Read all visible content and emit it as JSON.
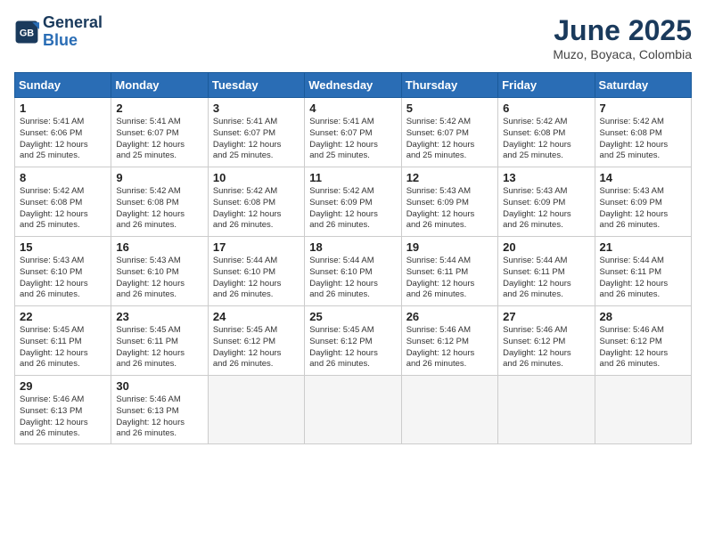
{
  "header": {
    "logo_line1": "General",
    "logo_line2": "Blue",
    "month_title": "June 2025",
    "location": "Muzo, Boyaca, Colombia"
  },
  "weekdays": [
    "Sunday",
    "Monday",
    "Tuesday",
    "Wednesday",
    "Thursday",
    "Friday",
    "Saturday"
  ],
  "weeks": [
    [
      {
        "day": "1",
        "info": "Sunrise: 5:41 AM\nSunset: 6:06 PM\nDaylight: 12 hours\nand 25 minutes."
      },
      {
        "day": "2",
        "info": "Sunrise: 5:41 AM\nSunset: 6:07 PM\nDaylight: 12 hours\nand 25 minutes."
      },
      {
        "day": "3",
        "info": "Sunrise: 5:41 AM\nSunset: 6:07 PM\nDaylight: 12 hours\nand 25 minutes."
      },
      {
        "day": "4",
        "info": "Sunrise: 5:41 AM\nSunset: 6:07 PM\nDaylight: 12 hours\nand 25 minutes."
      },
      {
        "day": "5",
        "info": "Sunrise: 5:42 AM\nSunset: 6:07 PM\nDaylight: 12 hours\nand 25 minutes."
      },
      {
        "day": "6",
        "info": "Sunrise: 5:42 AM\nSunset: 6:08 PM\nDaylight: 12 hours\nand 25 minutes."
      },
      {
        "day": "7",
        "info": "Sunrise: 5:42 AM\nSunset: 6:08 PM\nDaylight: 12 hours\nand 25 minutes."
      }
    ],
    [
      {
        "day": "8",
        "info": "Sunrise: 5:42 AM\nSunset: 6:08 PM\nDaylight: 12 hours\nand 25 minutes."
      },
      {
        "day": "9",
        "info": "Sunrise: 5:42 AM\nSunset: 6:08 PM\nDaylight: 12 hours\nand 26 minutes."
      },
      {
        "day": "10",
        "info": "Sunrise: 5:42 AM\nSunset: 6:08 PM\nDaylight: 12 hours\nand 26 minutes."
      },
      {
        "day": "11",
        "info": "Sunrise: 5:42 AM\nSunset: 6:09 PM\nDaylight: 12 hours\nand 26 minutes."
      },
      {
        "day": "12",
        "info": "Sunrise: 5:43 AM\nSunset: 6:09 PM\nDaylight: 12 hours\nand 26 minutes."
      },
      {
        "day": "13",
        "info": "Sunrise: 5:43 AM\nSunset: 6:09 PM\nDaylight: 12 hours\nand 26 minutes."
      },
      {
        "day": "14",
        "info": "Sunrise: 5:43 AM\nSunset: 6:09 PM\nDaylight: 12 hours\nand 26 minutes."
      }
    ],
    [
      {
        "day": "15",
        "info": "Sunrise: 5:43 AM\nSunset: 6:10 PM\nDaylight: 12 hours\nand 26 minutes."
      },
      {
        "day": "16",
        "info": "Sunrise: 5:43 AM\nSunset: 6:10 PM\nDaylight: 12 hours\nand 26 minutes."
      },
      {
        "day": "17",
        "info": "Sunrise: 5:44 AM\nSunset: 6:10 PM\nDaylight: 12 hours\nand 26 minutes."
      },
      {
        "day": "18",
        "info": "Sunrise: 5:44 AM\nSunset: 6:10 PM\nDaylight: 12 hours\nand 26 minutes."
      },
      {
        "day": "19",
        "info": "Sunrise: 5:44 AM\nSunset: 6:11 PM\nDaylight: 12 hours\nand 26 minutes."
      },
      {
        "day": "20",
        "info": "Sunrise: 5:44 AM\nSunset: 6:11 PM\nDaylight: 12 hours\nand 26 minutes."
      },
      {
        "day": "21",
        "info": "Sunrise: 5:44 AM\nSunset: 6:11 PM\nDaylight: 12 hours\nand 26 minutes."
      }
    ],
    [
      {
        "day": "22",
        "info": "Sunrise: 5:45 AM\nSunset: 6:11 PM\nDaylight: 12 hours\nand 26 minutes."
      },
      {
        "day": "23",
        "info": "Sunrise: 5:45 AM\nSunset: 6:11 PM\nDaylight: 12 hours\nand 26 minutes."
      },
      {
        "day": "24",
        "info": "Sunrise: 5:45 AM\nSunset: 6:12 PM\nDaylight: 12 hours\nand 26 minutes."
      },
      {
        "day": "25",
        "info": "Sunrise: 5:45 AM\nSunset: 6:12 PM\nDaylight: 12 hours\nand 26 minutes."
      },
      {
        "day": "26",
        "info": "Sunrise: 5:46 AM\nSunset: 6:12 PM\nDaylight: 12 hours\nand 26 minutes."
      },
      {
        "day": "27",
        "info": "Sunrise: 5:46 AM\nSunset: 6:12 PM\nDaylight: 12 hours\nand 26 minutes."
      },
      {
        "day": "28",
        "info": "Sunrise: 5:46 AM\nSunset: 6:12 PM\nDaylight: 12 hours\nand 26 minutes."
      }
    ],
    [
      {
        "day": "29",
        "info": "Sunrise: 5:46 AM\nSunset: 6:13 PM\nDaylight: 12 hours\nand 26 minutes."
      },
      {
        "day": "30",
        "info": "Sunrise: 5:46 AM\nSunset: 6:13 PM\nDaylight: 12 hours\nand 26 minutes."
      },
      {
        "day": "",
        "info": ""
      },
      {
        "day": "",
        "info": ""
      },
      {
        "day": "",
        "info": ""
      },
      {
        "day": "",
        "info": ""
      },
      {
        "day": "",
        "info": ""
      }
    ]
  ]
}
